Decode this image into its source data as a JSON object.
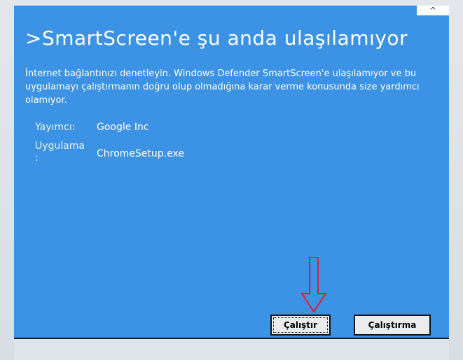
{
  "dialog": {
    "title": ">SmartScreen'e şu anda ulaşılamıyor",
    "description": "İnternet bağlantınızı denetleyin. Windows Defender SmartScreen'e ulaşılamıyor ve bu uygulamayı çalıştırmanın doğru olup olmadığına karar verme konusunda size yardımcı olamıyor.",
    "publisher_label": "Yayımcı:",
    "publisher_value": "Google Inc",
    "app_label_line1": "Uygulama",
    "app_label_line2": ":",
    "app_value": "ChromeSetup.exe",
    "collapse_glyph": "^",
    "run_button": "Çalıştır",
    "dont_run_button": "Çalıştırma"
  },
  "colors": {
    "dialog_bg": "#3c93e6",
    "annotation_arrow": "#e51c23"
  }
}
